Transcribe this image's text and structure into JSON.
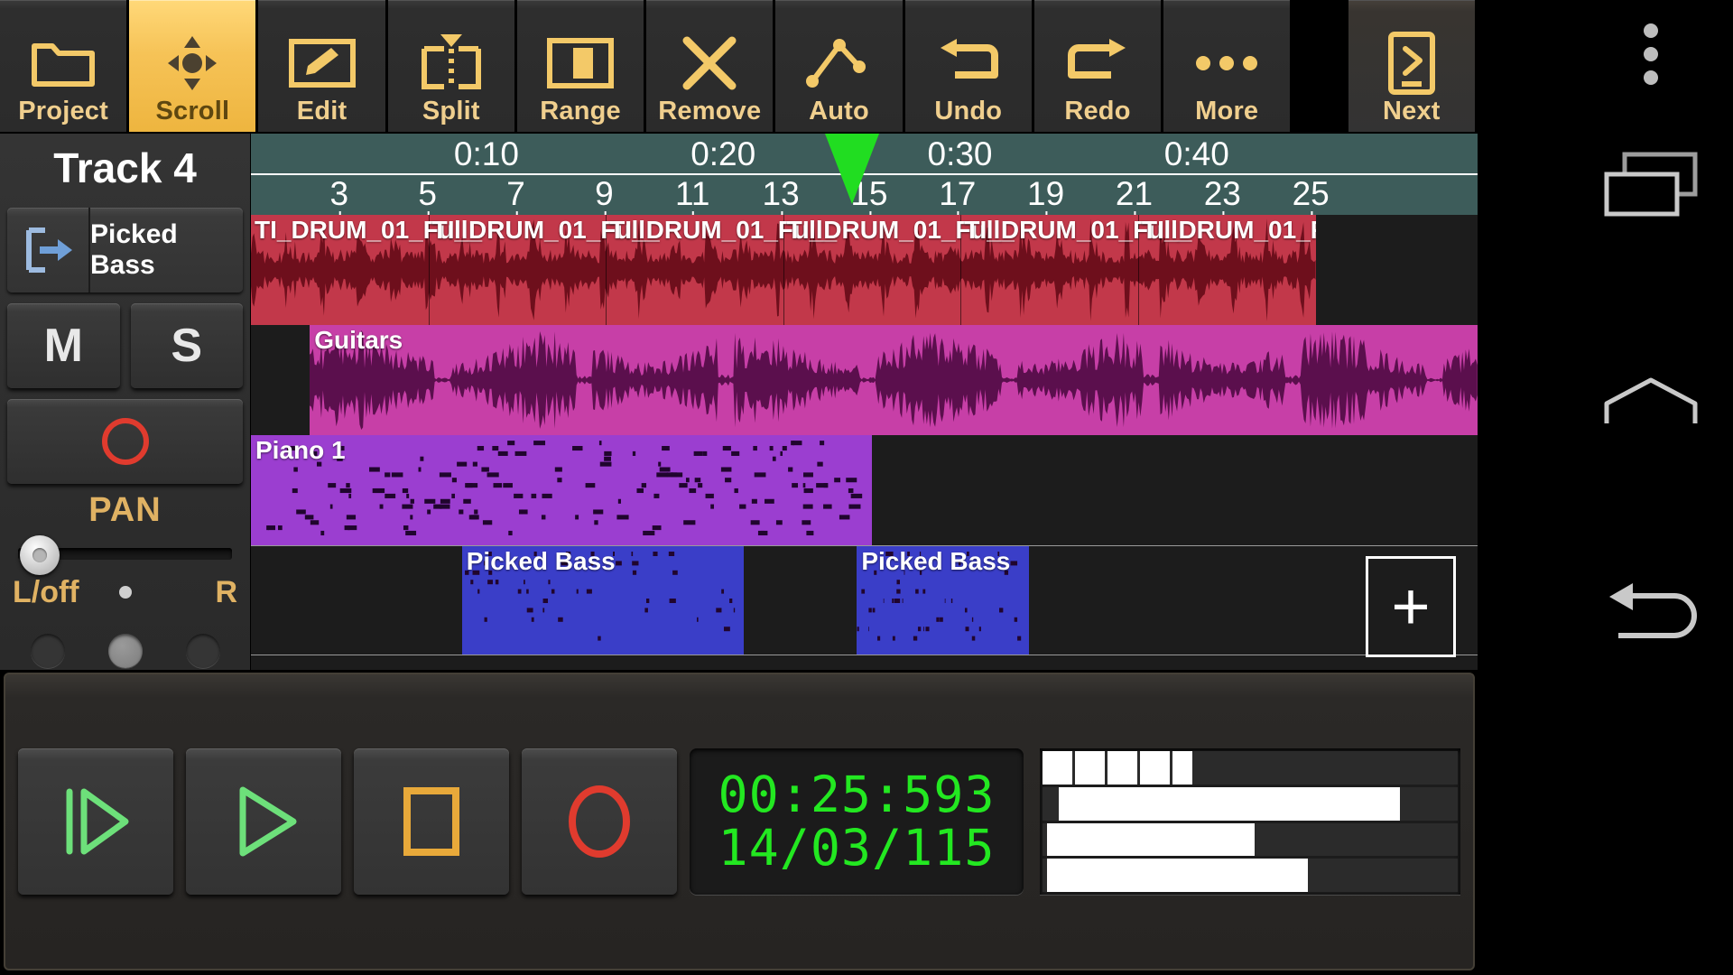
{
  "toolbar": {
    "buttons": [
      {
        "label": "Project",
        "icon": "folder-icon",
        "active": false
      },
      {
        "label": "Scroll",
        "icon": "move-icon",
        "active": true
      },
      {
        "label": "Edit",
        "icon": "pencil-icon",
        "active": false
      },
      {
        "label": "Split",
        "icon": "split-icon",
        "active": false
      },
      {
        "label": "Range",
        "icon": "range-icon",
        "active": false
      },
      {
        "label": "Remove",
        "icon": "close-x-icon",
        "active": false
      },
      {
        "label": "Auto",
        "icon": "automation-icon",
        "active": false
      },
      {
        "label": "Undo",
        "icon": "undo-arrow-icon",
        "active": false
      },
      {
        "label": "Redo",
        "icon": "redo-arrow-icon",
        "active": false
      },
      {
        "label": "More",
        "icon": "ellipsis-icon",
        "active": false
      }
    ],
    "next_button": {
      "label": "Next",
      "icon": "next-page-icon"
    }
  },
  "nav_strip": {
    "overflow": "overflow-menu-icon",
    "recents": "recent-apps-icon",
    "home": "home-icon",
    "back": "back-arrow-icon"
  },
  "track_panel": {
    "title": "Track 4",
    "instrument_icon": "instrument-input-icon",
    "instrument_name": "Picked Bass",
    "mute_label": "M",
    "solo_label": "S",
    "record_icon": "record-circle-icon",
    "pan_label": "PAN",
    "pan_left_label": "L/off",
    "pan_right_label": "R",
    "pan_value_percent": 3,
    "fx_dots": [
      "fx-slot-left",
      "fx-slot-center",
      "fx-slot-right"
    ]
  },
  "arrange": {
    "ruler": {
      "time_marks": [
        {
          "label": "0:10",
          "x_percent": 19.2
        },
        {
          "label": "0:20",
          "x_percent": 38.5
        },
        {
          "label": "0:30",
          "x_percent": 57.8
        },
        {
          "label": "0:40",
          "x_percent": 77.1
        }
      ],
      "bar_marks": [
        {
          "label": "3",
          "x_percent": 7.2
        },
        {
          "label": "5",
          "x_percent": 14.4
        },
        {
          "label": "7",
          "x_percent": 21.6
        },
        {
          "label": "9",
          "x_percent": 28.8
        },
        {
          "label": "11",
          "x_percent": 36.0
        },
        {
          "label": "13",
          "x_percent": 43.2
        },
        {
          "label": "15",
          "x_percent": 50.4
        },
        {
          "label": "17",
          "x_percent": 57.6
        },
        {
          "label": "19",
          "x_percent": 64.8
        },
        {
          "label": "21",
          "x_percent": 72.0
        },
        {
          "label": "23",
          "x_percent": 79.2
        },
        {
          "label": "25",
          "x_percent": 86.4
        }
      ],
      "playhead_x_percent": 49.0
    },
    "lanes": [
      {
        "name": "drums-lane",
        "clips": [
          {
            "label": "TI_DRUM_01_Full_",
            "type": "audio",
            "style": "audio-drum",
            "left_percent": 0.0,
            "width_percent": 86.8,
            "segments": 6,
            "color": "#c2384a"
          }
        ]
      },
      {
        "name": "guitars-lane",
        "clips": [
          {
            "label": "Guitars",
            "type": "audio",
            "style": "audio-gtr",
            "left_percent": 4.8,
            "width_percent": 95.2,
            "segments": 0,
            "color": "#c73fa7"
          }
        ]
      },
      {
        "name": "piano-lane",
        "clips": [
          {
            "label": "Piano 1",
            "type": "midi",
            "style": "midi-piano",
            "left_percent": 0.0,
            "width_percent": 50.6,
            "segments": 0,
            "color": "#9b3ed0"
          }
        ]
      },
      {
        "name": "bass-lane",
        "clips": [
          {
            "label": "Picked Bass",
            "type": "midi",
            "style": "midi-bass",
            "left_percent": 17.2,
            "width_percent": 23.0,
            "segments": 0,
            "color": "#3a3ec8"
          },
          {
            "label": "Picked Bass",
            "type": "midi",
            "style": "midi-bass",
            "left_percent": 49.4,
            "width_percent": 14.0,
            "segments": 0,
            "color": "#3a3ec8"
          }
        ]
      }
    ],
    "add_track_label": "+"
  },
  "transport": {
    "buttons": [
      {
        "name": "rewind-play-button",
        "icon": "play-from-start-icon",
        "color": "#6de07a"
      },
      {
        "name": "play-button",
        "icon": "play-icon",
        "color": "#6de07a"
      },
      {
        "name": "stop-button",
        "icon": "stop-square-icon",
        "color": "#e8a93a"
      },
      {
        "name": "record-button",
        "icon": "record-circle-icon",
        "color": "#e03b2e"
      }
    ],
    "time_display": {
      "time": "00:25:593",
      "bars": "14/03/115",
      "color": "#23e821"
    },
    "meters": [
      {
        "name": "meter-1",
        "fill_percent": 36,
        "segmented": true,
        "offset_percent": 0
      },
      {
        "name": "meter-2",
        "fill_percent": 82,
        "segmented": false,
        "offset_percent": 4
      },
      {
        "name": "meter-3",
        "fill_percent": 50,
        "segmented": false,
        "offset_percent": 1
      },
      {
        "name": "meter-4",
        "fill_percent": 63,
        "segmented": false,
        "offset_percent": 1
      }
    ]
  }
}
